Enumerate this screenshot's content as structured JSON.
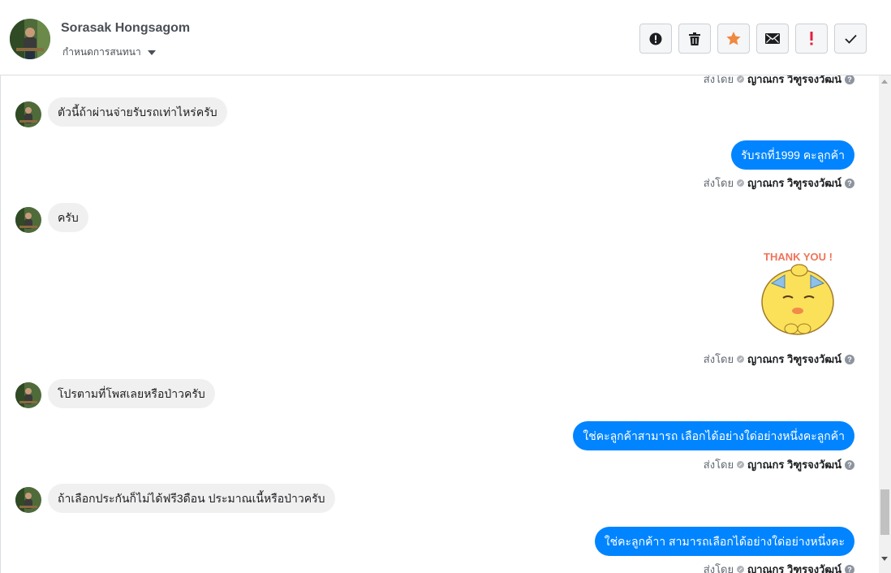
{
  "header": {
    "contact_name": "Sorasak Hongsagom",
    "conversation_menu_label": "กำหนดการสนทนา"
  },
  "actions": [
    {
      "name": "report-button",
      "icon": "alert-circle-icon"
    },
    {
      "name": "delete-button",
      "icon": "trash-icon"
    },
    {
      "name": "star-button",
      "icon": "star-icon"
    },
    {
      "name": "mark-unread-button",
      "icon": "envelope-icon"
    },
    {
      "name": "important-button",
      "icon": "exclamation-icon"
    },
    {
      "name": "mark-done-button",
      "icon": "check-icon"
    }
  ],
  "colors": {
    "outgoing_bubble": "#0084ff",
    "incoming_bubble": "#f1f0f0",
    "star": "#f0883e",
    "important": "#e41e3f"
  },
  "sent_by": {
    "prefix": "ส่งโดย",
    "agent": "ญาณกร วิฑูรจงวัฒน์"
  },
  "messages": [
    {
      "direction": "in",
      "text": "ตัวนี้ถ้าผ่านจ่ายรับรถเท่าไหร่ครับ"
    },
    {
      "direction": "out",
      "text": "รับรถที่1999 คะลูกค้า"
    },
    {
      "direction": "in",
      "text": "ครับ"
    },
    {
      "direction": "out-sticker",
      "sticker_text": "THANK YOU !"
    },
    {
      "direction": "in",
      "text": "โปรตามที่โพสเลยหรือป่าวครับ"
    },
    {
      "direction": "out",
      "text": "ใช่คะลูกค้าสามารถ เลือกได้อย่างใด่อย่างหนึ่งคะลูกค้า"
    },
    {
      "direction": "in",
      "text": "ถ้าเลือกประกันก็ไม่ได้ฟรี3ดือน ประมาณเนี้หรือป่าวครับ"
    },
    {
      "direction": "out",
      "text": "ใช่คะลูกค้าา สามารถเลือกได้อย่างใด่อย่างหนึ่งคะ"
    }
  ]
}
